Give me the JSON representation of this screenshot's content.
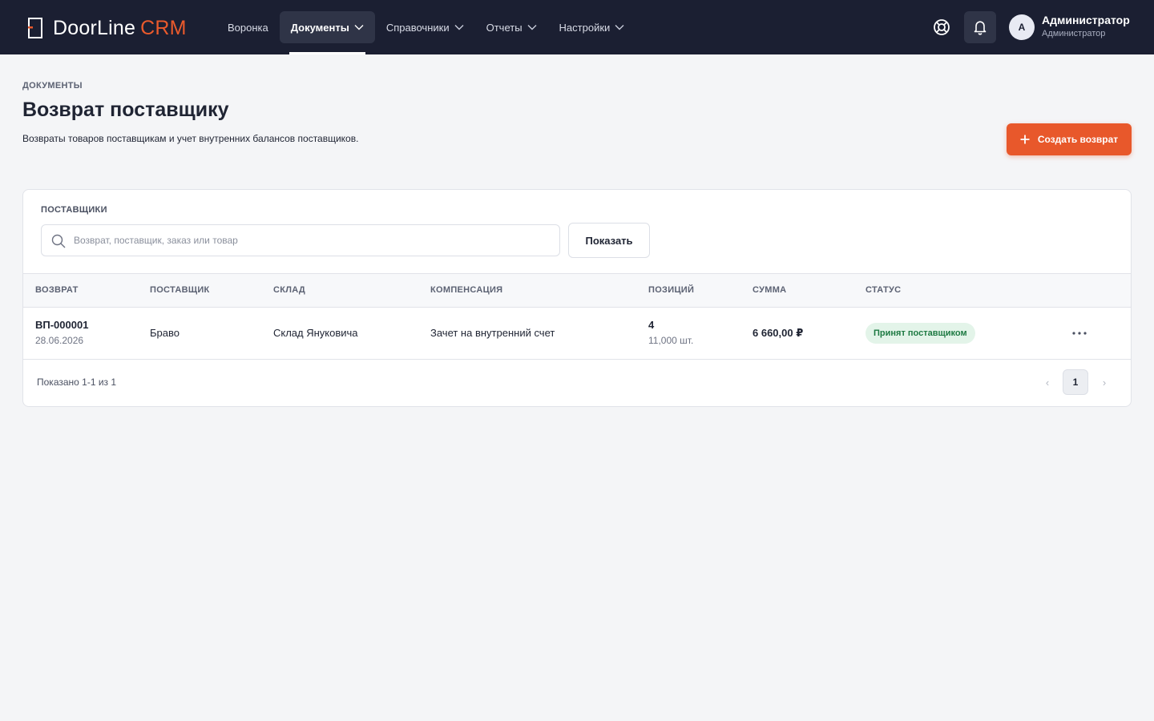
{
  "app": {
    "brand_name": "DoorLine",
    "brand_accent": "CRM",
    "accent_color": "#e8582b",
    "nav_background": "#1b1f32"
  },
  "nav": {
    "items": [
      {
        "label": "Воронка",
        "has_menu": false,
        "active": false
      },
      {
        "label": "Документы",
        "has_menu": true,
        "active": true
      },
      {
        "label": "Справочники",
        "has_menu": true,
        "active": false
      },
      {
        "label": "Отчеты",
        "has_menu": true,
        "active": false
      },
      {
        "label": "Настройки",
        "has_menu": true,
        "active": false
      }
    ]
  },
  "header_icons": {
    "help": "lifebuoy-icon",
    "notifications": "bell-icon"
  },
  "user": {
    "initial": "А",
    "name": "Администратор",
    "role": "Администратор"
  },
  "page": {
    "kicker": "ДОКУМЕНТЫ",
    "title": "Возврат поставщику",
    "description": "Возвраты товаров поставщикам и учет внутренних балансов поставщиков.",
    "create_button": "Создать возврат"
  },
  "filters": {
    "label": "ПОСТАВЩИКИ",
    "search_placeholder": "Возврат, поставщик, заказ или товар",
    "search_value": "",
    "show_button": "Показать"
  },
  "table": {
    "columns": [
      "ВОЗВРАТ",
      "ПОСТАВЩИК",
      "СКЛАД",
      "КОМПЕНСАЦИЯ",
      "ПОЗИЦИЙ",
      "СУММА",
      "СТАТУС"
    ],
    "rows": [
      {
        "number": "ВП-000001",
        "date": "28.06.2026",
        "supplier": "Браво",
        "warehouse": "Склад Януковича",
        "compensation": "Зачет на внутренний счет",
        "positions": "4",
        "quantity": "11,000 шт.",
        "amount": "6 660,00 ₽",
        "status": "Принят поставщиком",
        "status_color": "#1e7a43"
      }
    ]
  },
  "pagination": {
    "summary": "Показано 1-1 из 1",
    "prev": "‹",
    "current": "1",
    "next": "›"
  }
}
